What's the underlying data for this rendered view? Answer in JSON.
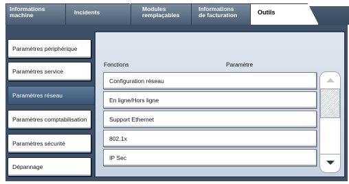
{
  "tabs": [
    {
      "label": "Informations\nmachine"
    },
    {
      "label": "Incidents"
    },
    {
      "label": "Modules\nremplaçables"
    },
    {
      "label": "Informations\nde facturation"
    },
    {
      "label": "Outils"
    }
  ],
  "sidebar": {
    "items": [
      {
        "label": "Paramètres périphérique"
      },
      {
        "label": "Paramètres service"
      },
      {
        "label": "Paramètres réseau",
        "selected": true
      },
      {
        "label": "Paramètres comptabilisation"
      },
      {
        "label": "Paramètres sécurité"
      },
      {
        "label": "Dépannage"
      }
    ]
  },
  "main": {
    "col_functions": "Fonctions",
    "col_parameter": "Paramètre",
    "rows": [
      {
        "label": "Configuration réseau"
      },
      {
        "label": "En ligne/Hors ligne"
      },
      {
        "label": "Support Ethernet"
      },
      {
        "label": "802.1x"
      },
      {
        "label": "IP Sec"
      }
    ]
  },
  "scrollbar": {
    "up_icon": "scroll-up-arrow-icon",
    "down_icon": "scroll-down-arrow-icon",
    "up_enabled": false,
    "down_enabled": true
  },
  "colors": {
    "frame": "#3f5066",
    "selected_item": "#4a6584",
    "panel": "#d3dce7"
  }
}
